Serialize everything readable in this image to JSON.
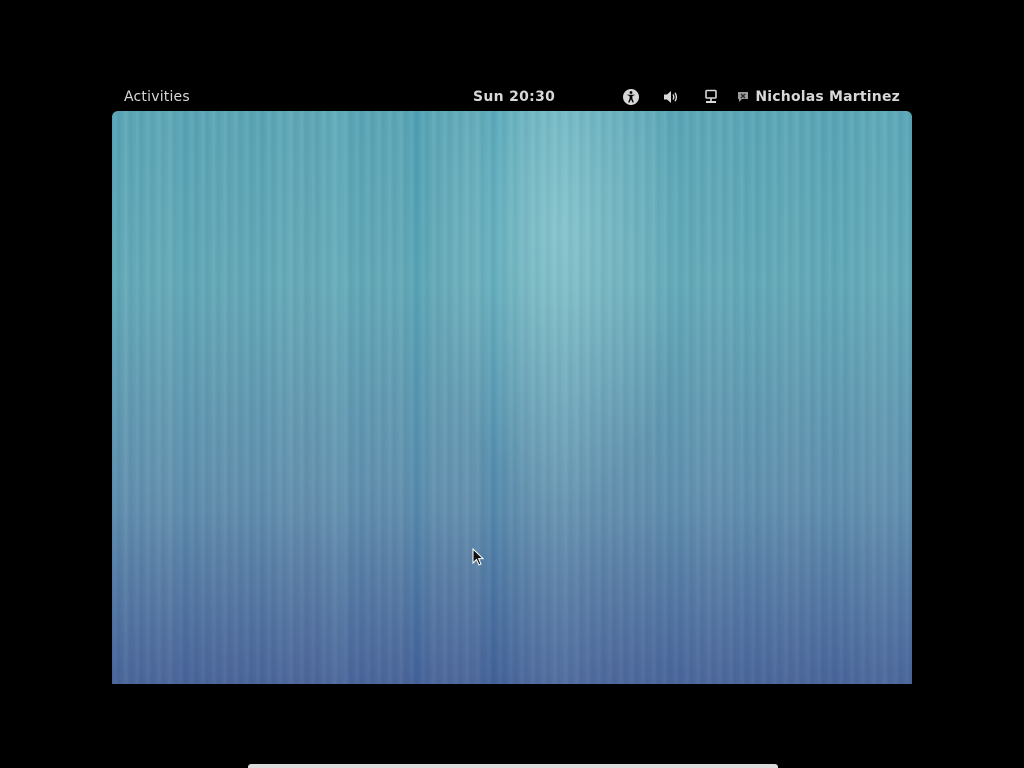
{
  "topbar": {
    "activities_label": "Activities",
    "clock_text": "Sun 20:30",
    "tray_icons": [
      "accessibility-icon",
      "volume-icon",
      "network-icon"
    ],
    "user": {
      "status_icon": "user-status-icon",
      "name": "Nicholas Martinez"
    }
  },
  "desktop": {
    "wallpaper_colors": {
      "top": "#5ea4b4",
      "middle": "#6aaeba",
      "bottom": "#5d78aa"
    }
  },
  "colors": {
    "background": "#000000",
    "topbar_text": "#d8d8d8"
  }
}
